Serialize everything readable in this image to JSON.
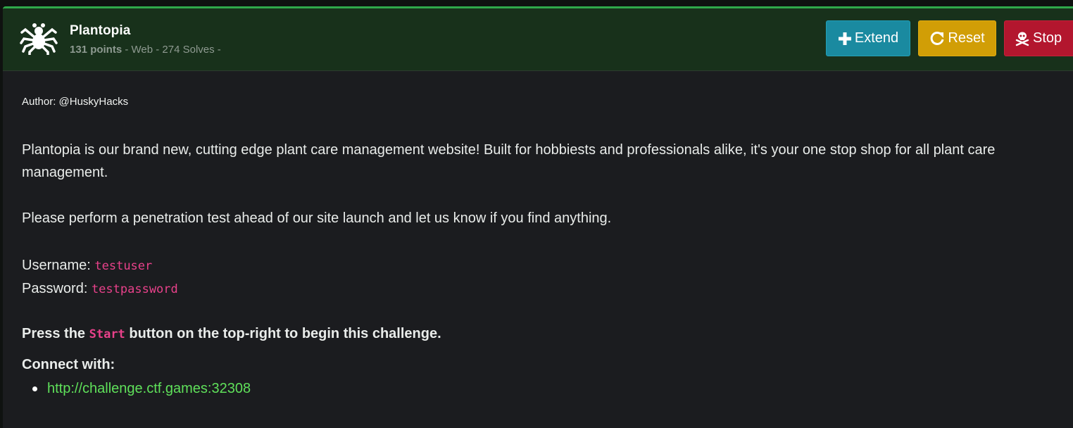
{
  "challenge": {
    "title": "Plantopia",
    "points": "131 points",
    "meta_rest": " - Web - 274 Solves -",
    "icon": "spider-icon"
  },
  "buttons": {
    "extend": {
      "label": "Extend",
      "icon": "plus-icon",
      "color": "#1a8aa0"
    },
    "reset": {
      "label": "Reset",
      "icon": "redo-icon",
      "color": "#d19e06"
    },
    "stop": {
      "label": "Stop",
      "icon": "skull-crossbones-icon",
      "color": "#b3162e"
    }
  },
  "description": {
    "author": "Author: @HuskyHacks",
    "paragraph1": "Plantopia is our brand new, cutting edge plant care management website! Built for hobbiests and professionals alike, it's your one stop shop for all plant care management.",
    "paragraph2": "Please perform a penetration test ahead of our site launch and let us know if you find anything.",
    "username_label": "Username: ",
    "username_value": "testuser",
    "password_label": "Password: ",
    "password_value": "testpassword",
    "press_prefix": "Press the ",
    "press_code": "Start",
    "press_suffix": " button on the top-right to begin this challenge.",
    "connect_label": "Connect with:",
    "connect_links": [
      "http://challenge.ctf.games:32308"
    ]
  },
  "colors": {
    "header_bg": "#18311b",
    "accent_green": "#2fa84a",
    "code_pink": "#e8418a",
    "link_green": "#5fe05a"
  }
}
